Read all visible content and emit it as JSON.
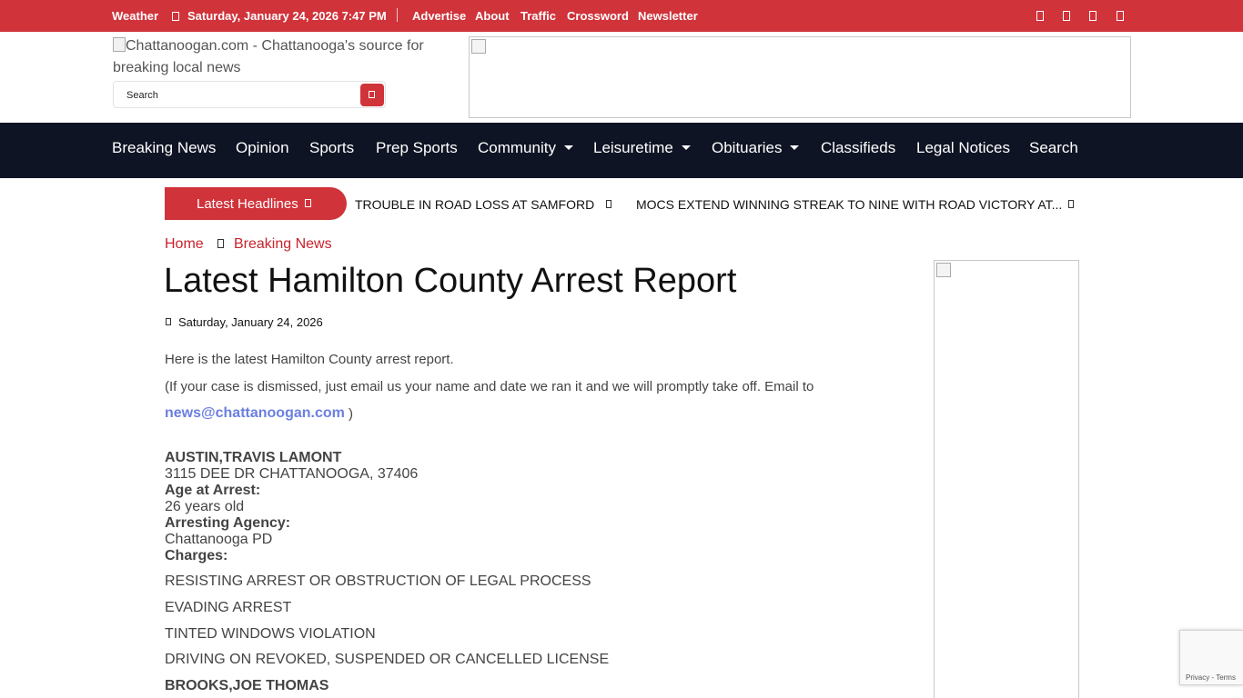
{
  "topbar": {
    "weather": "Weather",
    "datetime": "Saturday, January 24, 2026 7:47 PM",
    "links": [
      "Advertise",
      "About",
      "Traffic",
      "Crossword",
      "Newsletter"
    ]
  },
  "header": {
    "logo_alt": "Chattanoogan.com - Chattanooga's source for breaking local news",
    "search_placeholder": "Search"
  },
  "nav": {
    "items": [
      "Breaking News",
      "Opinion",
      "Sports",
      "Prep Sports",
      "Community",
      "Leisuretime",
      "Obituaries",
      "Classifieds",
      "Legal Notices",
      "Search"
    ]
  },
  "ticker": {
    "label": "Latest Headlines",
    "headlines": [
      "TROUBLE IN ROAD LOSS AT SAMFORD",
      "MOCS EXTEND WINNING STREAK TO NINE WITH ROAD VICTORY AT..."
    ]
  },
  "breadcrumb": {
    "home": "Home",
    "section": "Breaking News"
  },
  "article": {
    "title": "Latest Hamilton County Arrest Report",
    "date": "Saturday, January 24, 2026",
    "intro": "Here is the latest Hamilton County arrest report.",
    "dismissal_note": "(If your case is dismissed, just email us your name and date we ran it and we will promptly take off. Email to",
    "email": "news@chattanoogan.com",
    "email_close": ")",
    "records": [
      {
        "name": "AUSTIN,TRAVIS LAMONT",
        "address": "3115 DEE DR CHATTANOOGA, 37406",
        "age_label": "Age at Arrest:",
        "age": "26 years old",
        "agency_label": "Arresting Agency:",
        "agency": "Chattanooga PD",
        "charges_label": "Charges:",
        "charges": [
          "RESISTING ARREST OR OBSTRUCTION OF LEGAL PROCESS",
          "EVADING ARREST",
          "TINTED WINDOWS VIOLATION",
          "DRIVING ON REVOKED, SUSPENDED OR CANCELLED LICENSE"
        ]
      },
      {
        "name": "BROOKS,JOE THOMAS"
      }
    ]
  },
  "recaptcha": {
    "text": "Privacy - Terms"
  },
  "colors": {
    "brand_red": "#d0333a",
    "nav_bg": "#0f1424",
    "link_red": "#c8232c",
    "email_blue": "#6b7fe0"
  }
}
